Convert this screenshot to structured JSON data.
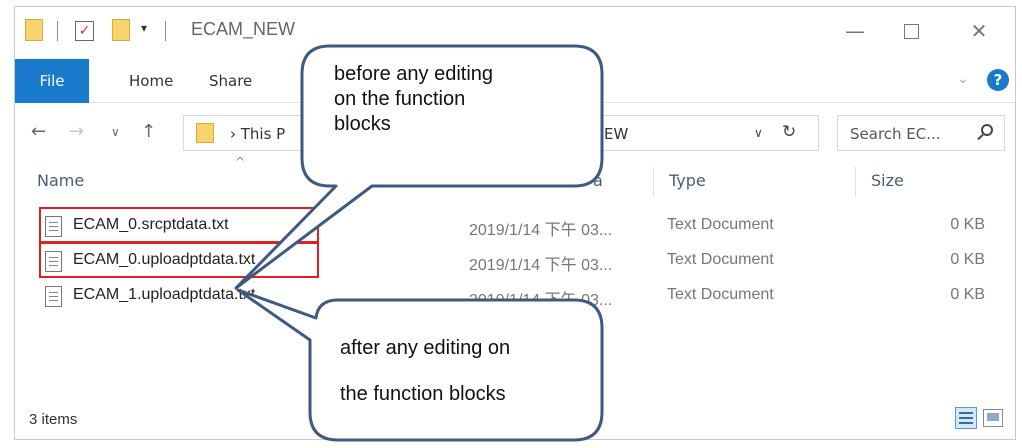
{
  "window": {
    "title": "ECAM_NEW",
    "qa_dropdown": "▾",
    "minimize": "—",
    "close": "✕"
  },
  "ribbon": {
    "tabs": [
      "File",
      "Home",
      "Share"
    ],
    "chevron": "⌄",
    "help": "?"
  },
  "address": {
    "back": "←",
    "forward": "→",
    "recent": "∨",
    "up": "↑",
    "crumb_start": "›  This P",
    "crumb_end": "EW",
    "dropdown": "∨",
    "refresh": "↻",
    "search_placeholder": "Search EC..."
  },
  "columns": {
    "sort_indicator": "^",
    "name": "Name",
    "date_fragment": "a",
    "type": "Type",
    "size": "Size"
  },
  "files": [
    {
      "name": "ECAM_0.srcptdata.txt",
      "date": "2019/1/14 下午 03...",
      "type": "Text Document",
      "size": "0 KB"
    },
    {
      "name": "ECAM_0.uploadptdata.txt",
      "date": "2019/1/14 下午 03...",
      "type": "Text Document",
      "size": "0 KB"
    },
    {
      "name": "ECAM_1.uploadptdata.txt",
      "date": "2019/1/14 下午 03...",
      "type": "Text Document",
      "size": "0 KB"
    }
  ],
  "status": {
    "items": "3 items"
  },
  "callouts": {
    "top": [
      "before any editing",
      "on the function",
      "blocks"
    ],
    "bottom": [
      "after any editing on",
      "the function blocks"
    ]
  },
  "colors": {
    "accent": "#1979ca",
    "highlight": "#e02020",
    "callout_fill": "#ffffff",
    "callout_border": "#3d5a80"
  }
}
